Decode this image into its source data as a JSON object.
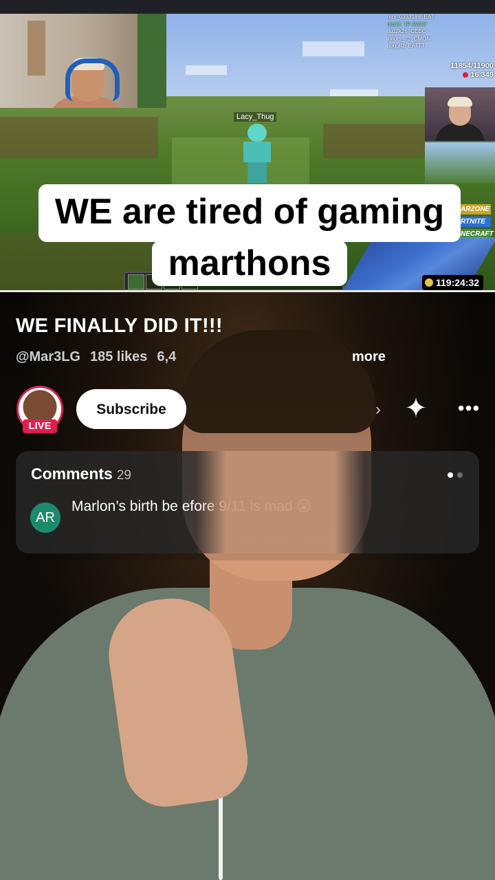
{
  "game": {
    "chat_lines": [
      "mrs_0333189: EAT",
      "mbhit: TP AWAY",
      "tluz2k26: CEEC",
      "ilinors_73: CMON",
      "boggitz: EATTT"
    ],
    "viewer_count": "11854/11900",
    "sub_count": "16.349",
    "nametag": "Lacy_Thug",
    "side_tags": [
      "ARZONE",
      "RTNITE",
      "NECRAFT"
    ],
    "timer": "119:24:32"
  },
  "caption": {
    "line1": "WE are tired of gaming",
    "line2": "marthons"
  },
  "short": {
    "title": "WE FINALLY DID IT!!!",
    "channel": "@Mar3LG",
    "likes": "185 likes",
    "views_partial": "6,4",
    "more_label": "more"
  },
  "channel_row": {
    "live_badge": "LIVE",
    "subscribe_label": "Subscribe",
    "sparkle_icon": "✦",
    "more_icon": "•••"
  },
  "comments": {
    "label": "Comments",
    "count": "29",
    "author_initials": "AR",
    "text": "Marlon’s birth be                                        efore 9/11 is mad 😮"
  },
  "colors": {
    "live_red": "#e01e4f",
    "avatar_green": "#1e8a6d"
  }
}
